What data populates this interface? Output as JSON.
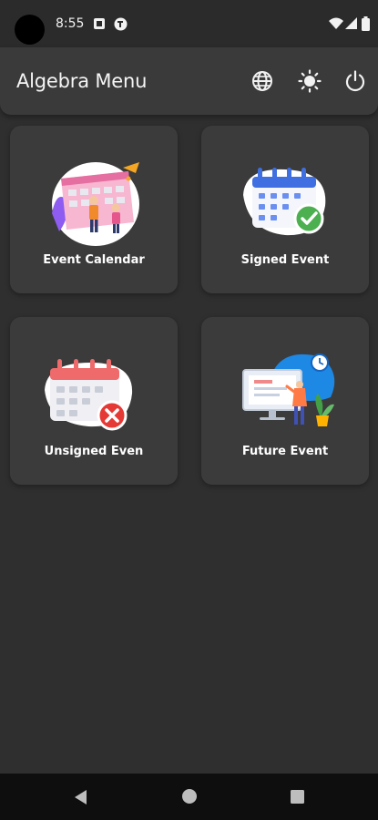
{
  "status_bar": {
    "time": "8:55",
    "left_icons": [
      "notification-square-icon",
      "app-notification-icon"
    ],
    "right_icons": [
      "wifi-icon",
      "cellular-signal-icon",
      "battery-icon"
    ]
  },
  "app_bar": {
    "title": "Algebra Menu",
    "actions": [
      "globe-icon",
      "brightness-icon",
      "power-icon"
    ]
  },
  "menu": {
    "items": [
      {
        "label": "Event Calendar",
        "icon": "event-calendar-illustration"
      },
      {
        "label": "Signed Event",
        "icon": "signed-calendar-illustration"
      },
      {
        "label": "Unsigned Even",
        "icon": "unsigned-calendar-illustration"
      },
      {
        "label": "Future Event",
        "icon": "future-event-illustration"
      }
    ]
  },
  "nav_bar": {
    "buttons": [
      "back-icon",
      "home-icon",
      "recents-icon"
    ]
  },
  "colors": {
    "background": "#2f2f2f",
    "app_bar": "#3a3a3a",
    "card": "#3b3b3b",
    "signed_accent": "#4caf50",
    "unsigned_accent": "#e53935",
    "calendar_blue": "#3f6fe0",
    "calendar_red": "#ef6a6a"
  }
}
